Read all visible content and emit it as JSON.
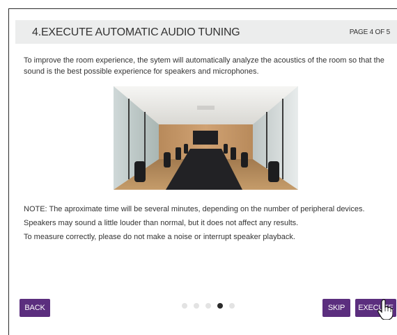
{
  "header": {
    "title": "4.EXECUTE AUTOMATIC AUDIO TUNING",
    "page_indicator": "PAGE 4 OF 5"
  },
  "intro_text": "To improve the room experience, the sytem will automatically analyze the acoustics of the room so that the sound is the best possible experience for speakers and microphones.",
  "image": {
    "alt": "conference-room-photo"
  },
  "notes": [
    "NOTE: The aproximate time will be several minutes, depending on the number of peripheral devices.",
    "Speakers may sound a little louder than normal, but it does not affect any results.",
    "To measure correctly, please do not make a noise or interrupt speaker playback."
  ],
  "buttons": {
    "back": "BACK",
    "skip": "SKIP",
    "execute": "EXECUTE"
  },
  "pagination": {
    "total": 5,
    "current": 4
  },
  "colors": {
    "button_bg": "#5b2e7e",
    "header_bg": "#eceded",
    "active_dot": "#2b2b2b",
    "inactive_dot": "#e3e3e3"
  }
}
